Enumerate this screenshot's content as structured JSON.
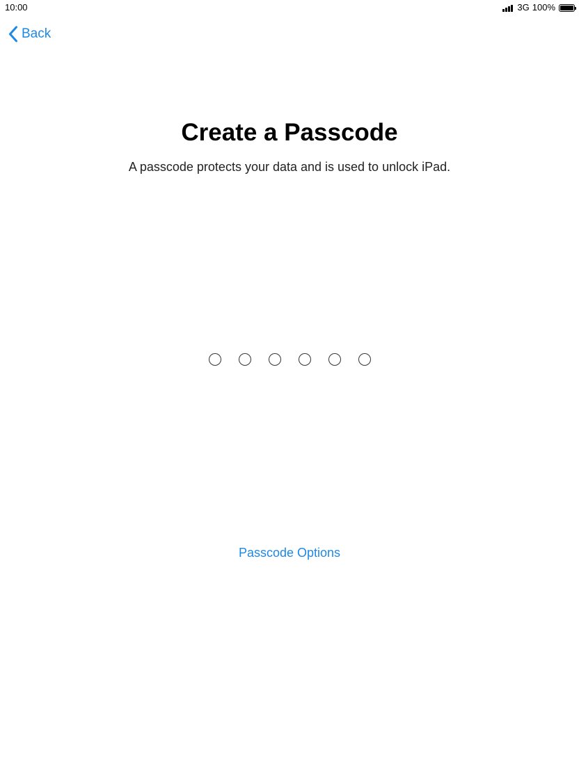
{
  "status_bar": {
    "time": "10:00",
    "network": "3G",
    "battery": "100%"
  },
  "nav": {
    "back_label": "Back",
    "back_icon": "chevron-left-icon"
  },
  "content": {
    "title": "Create a Passcode",
    "subtitle": "A passcode protects your data and is used to unlock iPad.",
    "passcode_length": 6,
    "digits_entered": 0
  },
  "options": {
    "label": "Passcode Options"
  },
  "colors": {
    "accent": "#1e88e5",
    "text": "#000000",
    "background": "#ffffff"
  }
}
